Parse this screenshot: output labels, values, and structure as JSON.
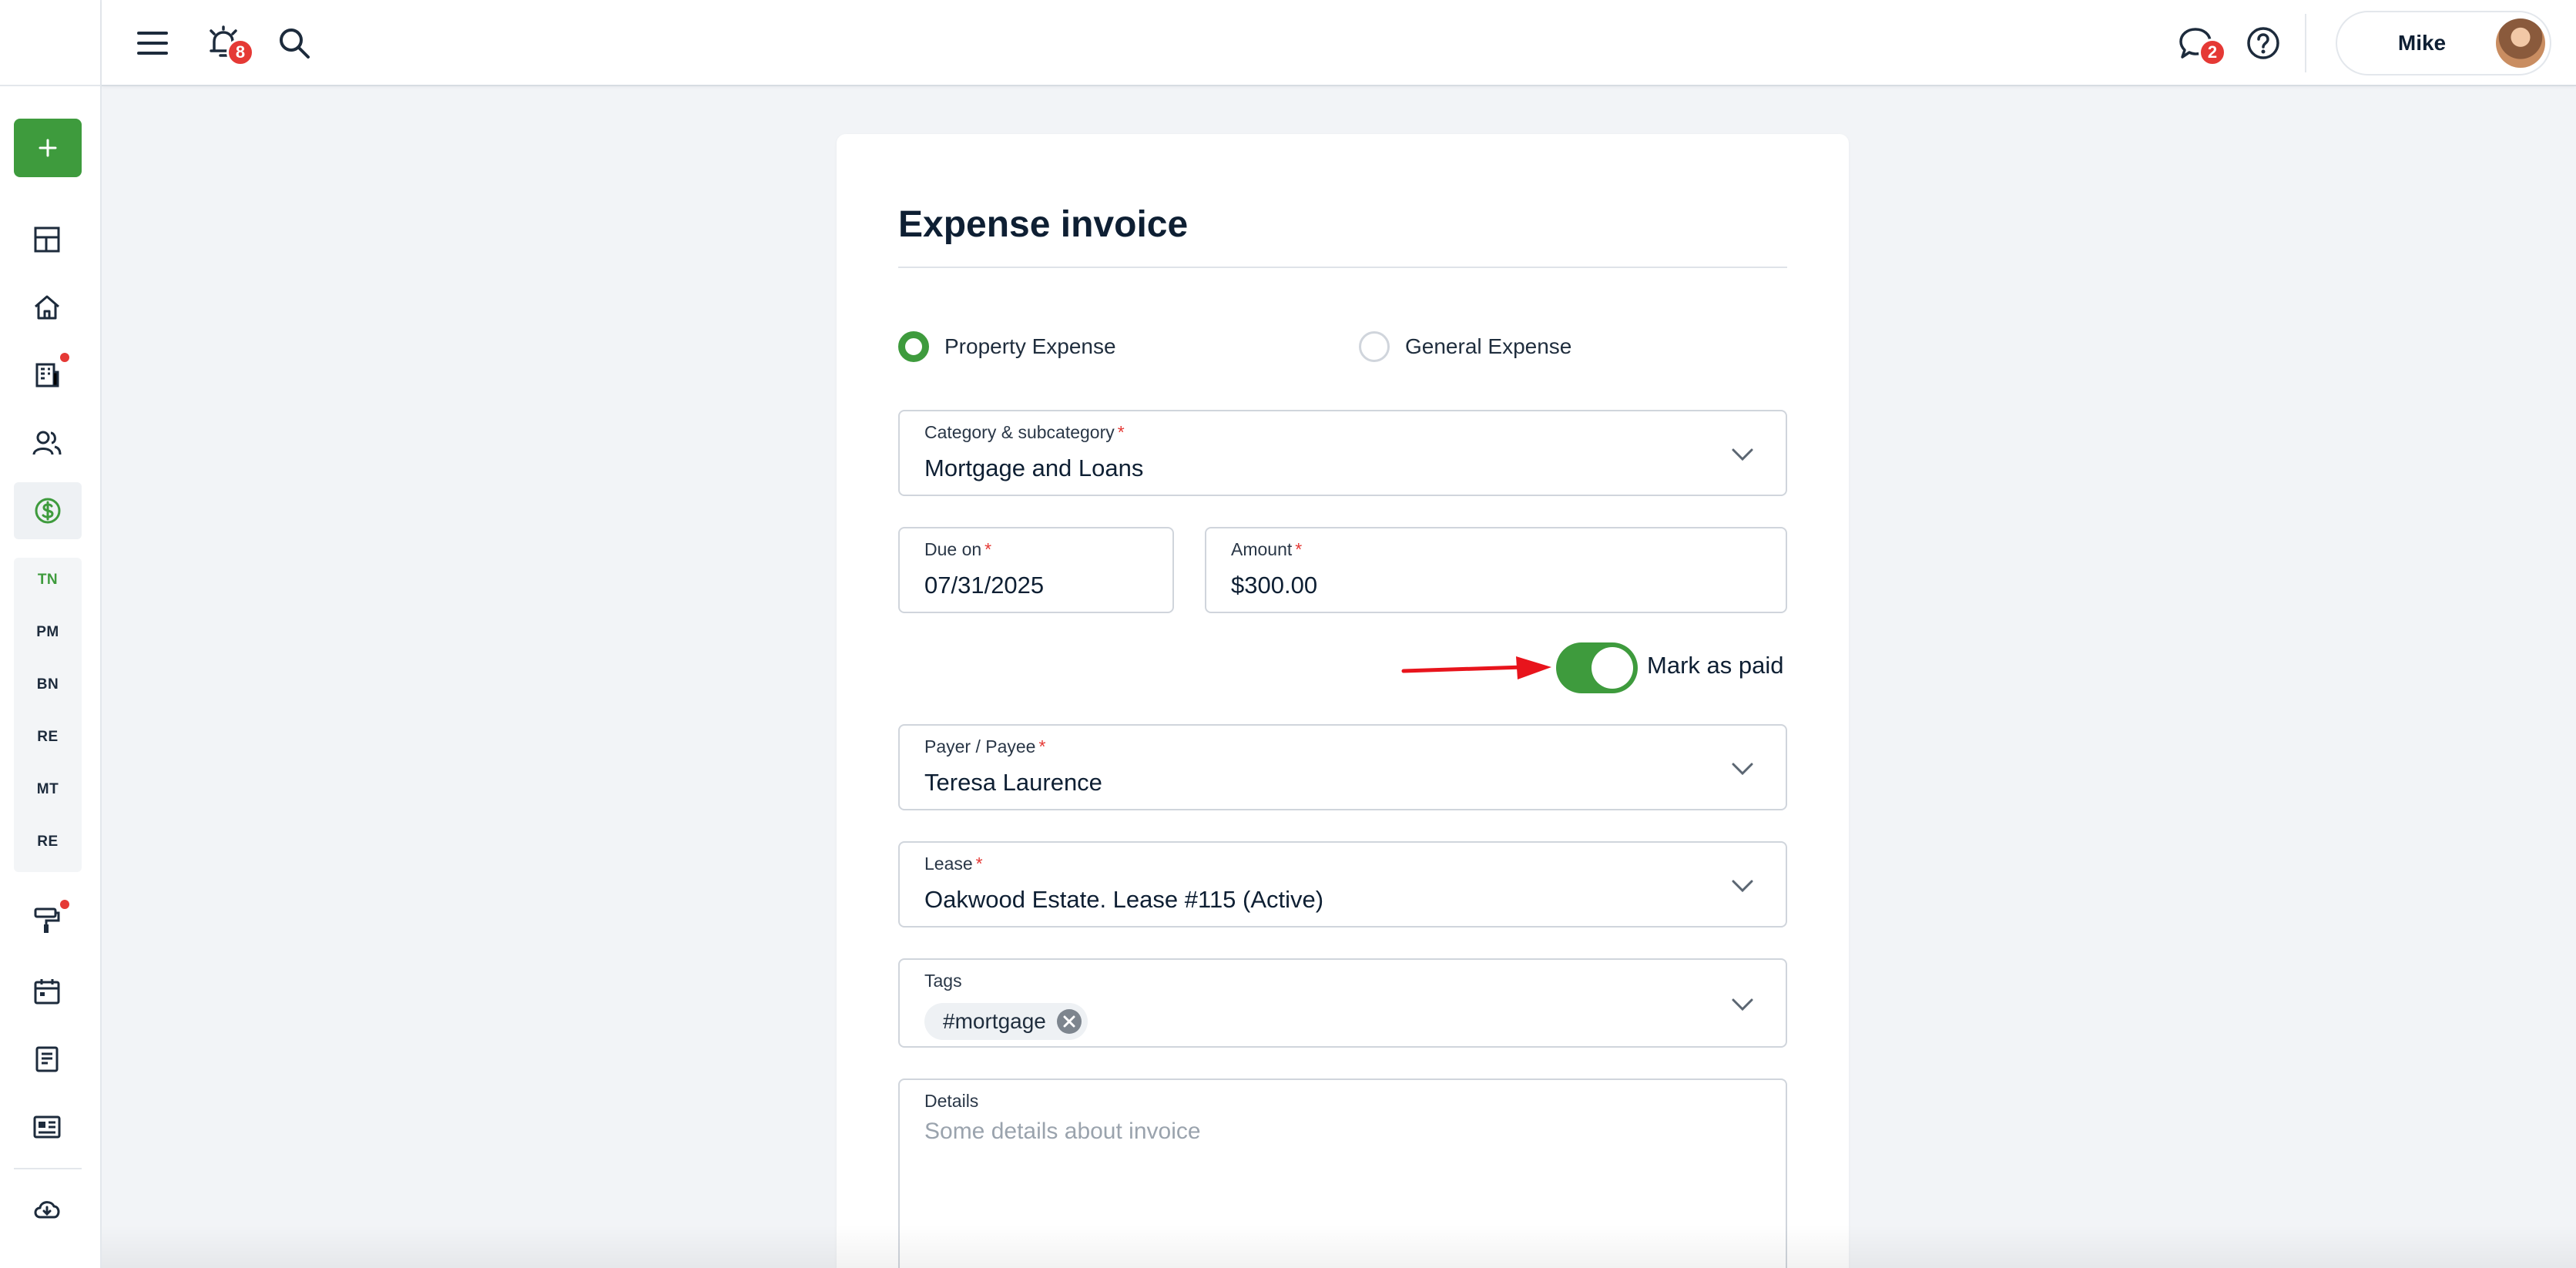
{
  "topbar": {
    "notifications_count": "8",
    "messages_count": "2",
    "user_name": "Mike"
  },
  "sidebar": {
    "sub_items": [
      "TN",
      "PM",
      "BN",
      "RE",
      "MT",
      "RE"
    ]
  },
  "form": {
    "title": "Expense invoice",
    "expense_types": [
      {
        "label": "Property Expense",
        "selected": true
      },
      {
        "label": "General Expense",
        "selected": false
      }
    ],
    "category": {
      "label": "Category & subcategory",
      "required": "*",
      "value": "Mortgage and Loans"
    },
    "due_on": {
      "label": "Due on",
      "required": "*",
      "value": "07/31/2025"
    },
    "amount": {
      "label": "Amount",
      "required": "*",
      "value": "$300.00"
    },
    "mark_as_paid": {
      "label": "Mark as paid",
      "on": true
    },
    "payee": {
      "label": "Payer / Payee",
      "required": "*",
      "value": "Teresa Laurence"
    },
    "lease": {
      "label": "Lease",
      "required": "*",
      "value": "Oakwood Estate. Lease #115 (Active)"
    },
    "tags": {
      "label": "Tags",
      "items": [
        "#mortgage"
      ]
    },
    "details": {
      "label": "Details",
      "placeholder": "Some details about invoice"
    }
  },
  "colors": {
    "accent_green": "#3e9b3d",
    "badge_red": "#e53935",
    "annotation_arrow": "#e8141c"
  },
  "icons": {
    "sidebar": [
      "plus-icon",
      "dashboard-icon",
      "home-icon",
      "building-icon",
      "people-icon",
      "dollar-icon",
      "paint-roller-icon",
      "calendar-icon",
      "document-icon",
      "id-card-icon",
      "cloud-download-icon"
    ],
    "topbar": [
      "menu-icon",
      "alarm-bell-icon",
      "search-icon",
      "chat-icon",
      "help-icon"
    ]
  }
}
